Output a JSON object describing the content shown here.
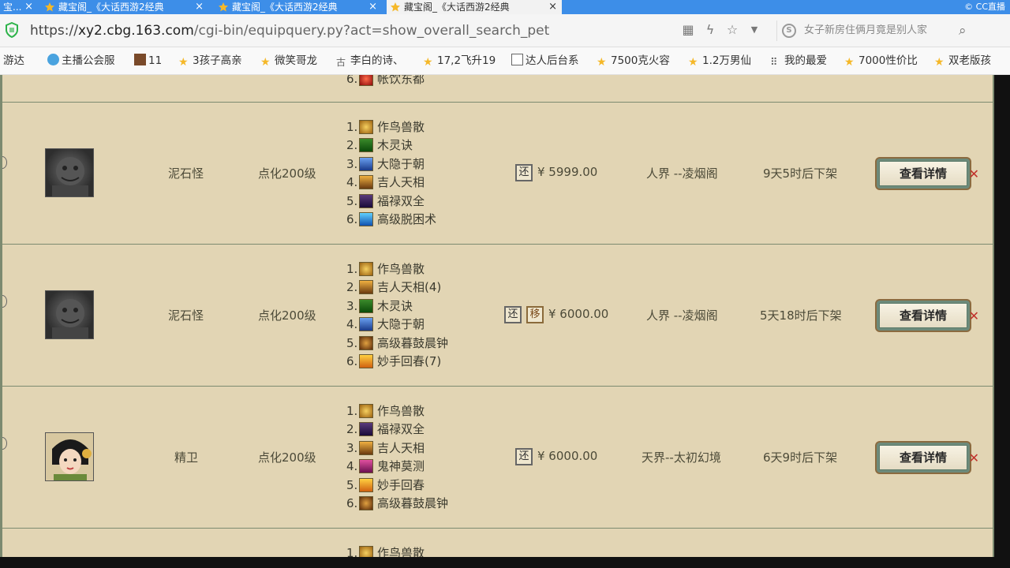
{
  "tabs": [
    {
      "label": "宝..."
    },
    {
      "label": "藏宝阁_《大话西游2经典"
    },
    {
      "label": "藏宝阁_《大话西游2经典"
    },
    {
      "label": "藏宝阁_《大话西游2经典"
    }
  ],
  "tabbar_right": "© CC直播",
  "address": {
    "scheme": "https://",
    "host": "xy2.cbg.163.com",
    "path": "/cgi-bin/equipquery.py?act=show_overall_search_pet",
    "search_text": "女子新房住俩月竟是别人家"
  },
  "bookmarks": [
    {
      "label": "游达"
    },
    {
      "label": "主播公会服"
    },
    {
      "label": "11"
    },
    {
      "label": "3孩子高亲"
    },
    {
      "label": "微笑哥龙"
    },
    {
      "label": "李白的诗、"
    },
    {
      "label": "17,2飞升19"
    },
    {
      "label": "达人后台系"
    },
    {
      "label": "7500克火容"
    },
    {
      "label": "1.2万男仙"
    },
    {
      "label": "我的最爱"
    },
    {
      "label": "7000性价比"
    },
    {
      "label": "双老版孩"
    }
  ],
  "partial_top": {
    "num": "6.",
    "skill": "帐饮东都"
  },
  "rows": [
    {
      "name": "泥石怪",
      "level": "点化200级",
      "skills": [
        {
          "num": "1.",
          "label": "作鸟兽散"
        },
        {
          "num": "2.",
          "label": "木灵诀"
        },
        {
          "num": "3.",
          "label": "大隐于朝"
        },
        {
          "num": "4.",
          "label": "吉人天相"
        },
        {
          "num": "5.",
          "label": "福禄双全"
        },
        {
          "num": "6.",
          "label": "高级脱困术"
        }
      ],
      "badges": [
        "还"
      ],
      "price": "¥ 5999.00",
      "server": "人界 --凌烟阁",
      "time_left": "9天5时后下架",
      "button": "查看详情"
    },
    {
      "name": "泥石怪",
      "level": "点化200级",
      "skills": [
        {
          "num": "1.",
          "label": "作鸟兽散"
        },
        {
          "num": "2.",
          "label": "吉人天相(4)"
        },
        {
          "num": "3.",
          "label": "木灵诀"
        },
        {
          "num": "4.",
          "label": "大隐于朝"
        },
        {
          "num": "5.",
          "label": "高级暮鼓晨钟"
        },
        {
          "num": "6.",
          "label": "妙手回春(7)"
        }
      ],
      "badges": [
        "还",
        "移"
      ],
      "price": "¥ 6000.00",
      "server": "人界 --凌烟阁",
      "time_left": "5天18时后下架",
      "button": "查看详情"
    },
    {
      "name": "精卫",
      "level": "点化200级",
      "skills": [
        {
          "num": "1.",
          "label": "作鸟兽散"
        },
        {
          "num": "2.",
          "label": "福禄双全"
        },
        {
          "num": "3.",
          "label": "吉人天相"
        },
        {
          "num": "4.",
          "label": "鬼神莫测"
        },
        {
          "num": "5.",
          "label": "妙手回春"
        },
        {
          "num": "6.",
          "label": "高级暮鼓晨钟"
        }
      ],
      "badges": [
        "还"
      ],
      "price": "¥ 6000.00",
      "server": "天界--太初幻境",
      "time_left": "6天9时后下架",
      "button": "查看详情"
    }
  ],
  "partial_bottom": {
    "num": "1.",
    "skill": "作鸟兽散"
  }
}
